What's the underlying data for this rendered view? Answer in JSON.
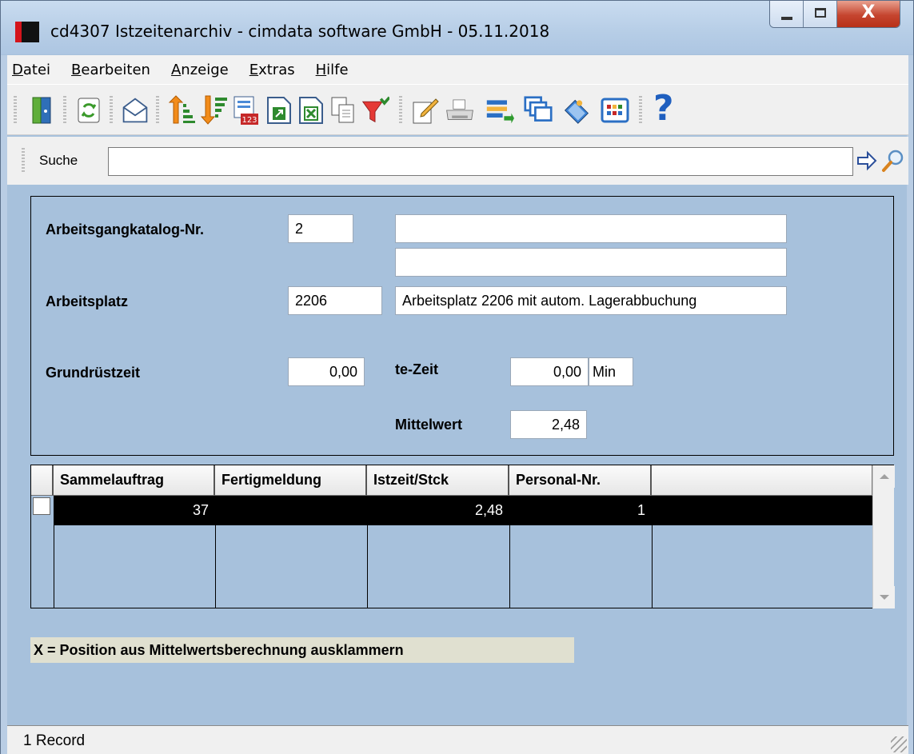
{
  "window": {
    "title": "cd4307 Istzeitenarchiv - cimdata software GmbH - 05.11.2018",
    "close_glyph": "X"
  },
  "menu": [
    {
      "label": "Datei"
    },
    {
      "label": "Bearbeiten"
    },
    {
      "label": "Anzeige"
    },
    {
      "label": "Extras"
    },
    {
      "label": "Hilfe"
    }
  ],
  "toolbar": {
    "icons": [
      "exit-door-icon",
      "refresh-icon",
      "email-icon",
      "sort-ascending-icon",
      "sort-descending-icon",
      "calendar-123-icon",
      "export-icon",
      "excel-icon",
      "copy-icon",
      "filter-icon",
      "edit-icon",
      "print-icon",
      "transfer-icon",
      "windows-icon",
      "book-icon",
      "grid-view-icon",
      "help-icon"
    ],
    "help_glyph": "?",
    "calendar_text": "123"
  },
  "search": {
    "label": "Suche",
    "value": ""
  },
  "form": {
    "katalog_label": "Arbeitsgangkatalog-Nr.",
    "katalog_nr": "2",
    "katalog_desc1": "",
    "katalog_desc2": "",
    "arbeitsplatz_label": "Arbeitsplatz",
    "arbeitsplatz_nr": "2206",
    "arbeitsplatz_desc": "Arbeitsplatz 2206 mit autom. Lagerabbuchung",
    "grundruestzeit_label": "Grundrüstzeit",
    "grundruestzeit": "0,00",
    "tezeit_label": "te-Zeit",
    "tezeit": "0,00",
    "tezeit_unit": "Min",
    "mittelwert_label": "Mittelwert",
    "mittelwert": "2,48"
  },
  "grid": {
    "columns": [
      "Sammelauftrag",
      "Fertigmeldung",
      "Istzeit/Stck",
      "Personal-Nr.",
      ""
    ],
    "rows": [
      {
        "sammelauftrag": "37",
        "fertigmeldung": "",
        "istzeit": "2,48",
        "personal_nr": "1"
      }
    ]
  },
  "hint": "X = Position aus Mittelwertsberechnung ausklammern",
  "status": "1 Record",
  "colors": {
    "panel": "#a7c1dc",
    "selected_row": "#000000",
    "brand_red": "#d4141b"
  }
}
